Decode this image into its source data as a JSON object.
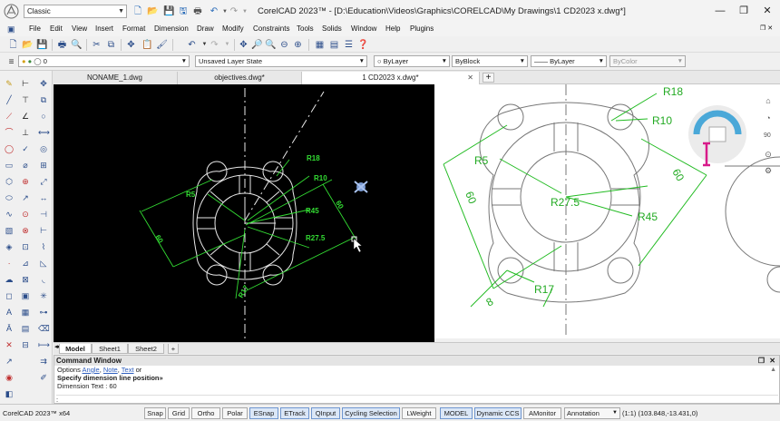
{
  "titlebar": {
    "workspace": "Classic",
    "title": "CorelCAD 2023™ - [D:\\Education\\Videos\\Graphics\\CORELCAD\\My Drawings\\1 CD2023 x.dwg*]"
  },
  "menu": [
    "File",
    "Edit",
    "View",
    "Insert",
    "Format",
    "Dimension",
    "Draw",
    "Modify",
    "Constraints",
    "Tools",
    "Solids",
    "Window",
    "Help",
    "Plugins"
  ],
  "properties_bar": {
    "layer": "0",
    "layer_state": "Unsaved Layer State",
    "color": "ByLayer",
    "linetype": "ByBlock",
    "lineweight": "ByLayer",
    "plotstyle": "ByColor"
  },
  "doc_tabs": [
    {
      "label": "NONAME_1.dwg"
    },
    {
      "label": "objectives.dwg*"
    },
    {
      "label": "1 CD2023 x.dwg*"
    }
  ],
  "drawing_labels": {
    "r18": "R18",
    "r10": "R10",
    "r5": "R5",
    "r45": "R45",
    "r275": "R27.5",
    "r17": "R17",
    "d60a": "60",
    "d60b": "60",
    "d8": "8"
  },
  "overlay_labels": {
    "r18": "R18",
    "r10": "R10",
    "r5": "R5",
    "r275": "R27.5",
    "r45": "R45",
    "r17": "R17",
    "d60a": "60",
    "d60b": "60",
    "d8": "8"
  },
  "nav_widget": {
    "zoom": "90"
  },
  "layout_tabs": [
    "Model",
    "Sheet1",
    "Sheet2"
  ],
  "command_window": {
    "header": "Command Window",
    "line1_prefix": "Options",
    "line1_opt1": "Angle",
    "line1_opt2": "Note",
    "line1_opt3": "Text",
    "line1_suffix": "or",
    "line2": "Specify dimension line position»",
    "line3": "Dimension Text : 60",
    "prompt": ":"
  },
  "statusbar": {
    "app": "CorelCAD 2023™ x64",
    "buttons": [
      "Snap",
      "Grid",
      "Ortho",
      "Polar",
      "ESnap",
      "ETrack",
      "QInput",
      "Cycling Selection",
      "LWeight",
      "MODEL",
      "Dynamic CCS",
      "AMonitor"
    ],
    "annotation": "Annotation",
    "coords": "(1:1)   (103.848,-13.431,0)"
  },
  "colors": {
    "canvas_bg": "#000000",
    "dim_green": "#33dd33",
    "geometry_white": "#e8e8e8",
    "accent_blue": "#2b4d8a"
  }
}
